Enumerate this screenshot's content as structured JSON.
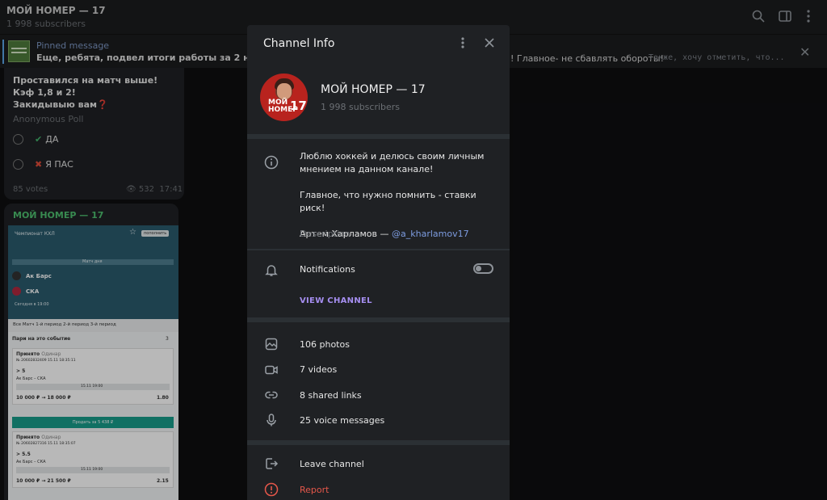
{
  "chat": {
    "title": "МОЙ НОМЕР — 17",
    "subscribers": "1 998 subscribers",
    "header_icons": [
      "search-icon",
      "sidebar-toggle-icon",
      "more-vertical-icon"
    ]
  },
  "pinned": {
    "title": "Pinned message",
    "text": "Еще, ребята, подвел итоги работы за 2 недели!",
    "text_right": "! Главное- не сбавлять обороты!",
    "text_extra": "Также, хочу отметить, что..."
  },
  "poll": {
    "question_line1": "Проставился на матч выше!",
    "question_line2": "Кэф 1,8 и 2!",
    "question_line3": " Закидывыю вам",
    "question_emoji": "❓",
    "type": "Anonymous Poll",
    "options": [
      "ДА",
      "Я ПАС"
    ],
    "option_marks": [
      "✔",
      "✖"
    ],
    "votes": "85 votes",
    "views": "532",
    "time": "17:41"
  },
  "image_message": {
    "author": "МОЙ НОМЕР — 17",
    "screenshot": {
      "league": "Чемпионат КХЛ",
      "button": "пополнить",
      "match_day": "Матч дня",
      "team1": "Ак Барс",
      "team2": "СКА",
      "time": "Сегодня в 19:00",
      "tabs": "Все   Матч   1-й период   2-й период   3-й период",
      "section": "Пари на это событие",
      "section_count": "3",
      "bet1_status": "Принято",
      "bet1_type": "Одинар",
      "bet1_id": "№ 20602832409   15.11   18:35:11",
      "bet1_pick": "> 5",
      "bet1_match": "Ак Барс – СКА",
      "bet1_date": "15.11 19:00",
      "bet1_amount": "10 000 ₽  → 18 000 ₽",
      "bet1_odds": "1.80",
      "sell_button": "Продать за 5 438 ₽",
      "bet2_status": "Принято",
      "bet2_type": "Одинар",
      "bet2_id": "№ 20602827316   15.11   18:35:07",
      "bet2_pick": "> 5.5",
      "bet2_match": "Ак Барс – СКА",
      "bet2_date": "15.11 19:00",
      "bet2_amount": "10 000 ₽  → 21 500 ₽",
      "bet2_odds": "2.15"
    }
  },
  "modal": {
    "title": "Channel Info",
    "channel_name": "МОЙ НОМЕР — 17",
    "subscribers": "1 998 subscribers",
    "avatar_text": "МОЙ НОМЕР",
    "avatar_number": "17",
    "description_line1": "Люблю хоккей и делюсь своим личным",
    "description_line2": "мнением на данном канале!",
    "description_line3": "Главное, что нужно помнить - ставки риск!",
    "description_author": "Артем Харламов  — ",
    "description_handle": "@a_kharlamov17",
    "description_label": "Description",
    "notifications_label": "Notifications",
    "notifications_on": false,
    "view_channel": "VIEW CHANNEL",
    "media": [
      "106 photos",
      "7 videos",
      "8 shared links",
      "25 voice messages"
    ],
    "leave": "Leave channel",
    "report": "Report"
  },
  "colors": {
    "accent": "#a58ef0",
    "link": "#7d9ce0",
    "danger": "#e5574a",
    "author_green": "#4ec06f"
  }
}
